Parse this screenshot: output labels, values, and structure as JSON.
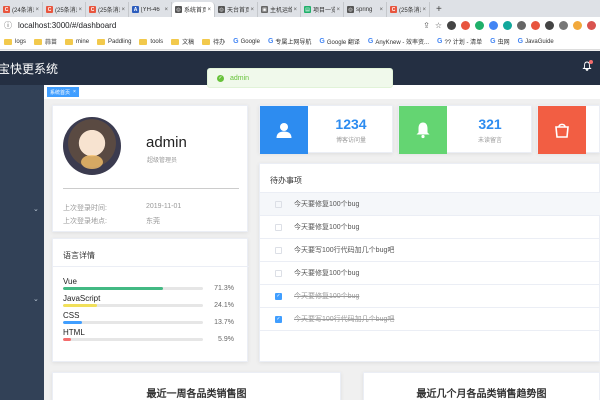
{
  "browser": {
    "tabs": [
      {
        "label": "(24条消息",
        "color": "#e8553e",
        "fav": "C",
        "active": false
      },
      {
        "label": "(25条消息",
        "color": "#e8553e",
        "fav": "C",
        "active": false
      },
      {
        "label": "(25条消息",
        "color": "#e8553e",
        "fav": "C",
        "active": false
      },
      {
        "label": "[YH-46",
        "color": "#2d5dbd",
        "fav": "A",
        "active": false
      },
      {
        "label": "系统首页",
        "color": "#555",
        "fav": "◎",
        "active": true
      },
      {
        "label": "天台首页",
        "color": "#555",
        "fav": "◎",
        "active": false
      },
      {
        "label": "主机运维",
        "color": "#666",
        "fav": "▣",
        "active": false
      },
      {
        "label": "项目一览",
        "color": "#1fb06a",
        "fav": "▤",
        "active": false
      },
      {
        "label": "spring",
        "color": "#555",
        "fav": "◎",
        "active": false
      },
      {
        "label": "(25条消息",
        "color": "#e8553e",
        "fav": "C",
        "active": false
      }
    ],
    "new_tab": "+",
    "url": "localhost:3000/#/dashboard",
    "bookmarks": [
      {
        "label": "logs",
        "type": "folder"
      },
      {
        "label": "蒜苗",
        "type": "folder"
      },
      {
        "label": "mine",
        "type": "folder"
      },
      {
        "label": "Paddling",
        "type": "folder"
      },
      {
        "label": "tools",
        "type": "folder"
      },
      {
        "label": "文稿",
        "type": "folder"
      },
      {
        "label": "待办",
        "type": "folder"
      },
      {
        "label": "Google",
        "type": "g"
      },
      {
        "label": "专属上网导航",
        "type": "g"
      },
      {
        "label": "Google 翻译",
        "type": "g"
      },
      {
        "label": "AnyKnew - 效率资...",
        "type": "g"
      },
      {
        "label": "?? 计划 - 清单",
        "type": "g"
      },
      {
        "label": "虫网",
        "type": "g"
      },
      {
        "label": "JavaGuide",
        "type": "g"
      }
    ]
  },
  "app": {
    "title": "宝快更系统",
    "tag_label": "系统首页",
    "tag_close": "×",
    "toast": "admin"
  },
  "user": {
    "name": "admin",
    "role": "超级管理员",
    "last_login_label": "上次登录时间:",
    "last_login_value": "2019-11-01",
    "last_place_label": "上次登录地点:",
    "last_place_value": "东莞"
  },
  "languages": {
    "title": "语言详情",
    "items": [
      {
        "name": "Vue",
        "pct": "71.3%",
        "value": 71.3,
        "color": "#42b983"
      },
      {
        "name": "JavaScript",
        "pct": "24.1%",
        "value": 24.1,
        "color": "#f1e05a"
      },
      {
        "name": "CSS",
        "pct": "13.7%",
        "value": 13.7,
        "color": "#409eff"
      },
      {
        "name": "HTML",
        "pct": "5.9%",
        "value": 5.9,
        "color": "#f56c6c"
      }
    ]
  },
  "stats": [
    {
      "num": "1234",
      "label": "博客访问量",
      "color": "#2d8cf0",
      "icon": "user-icon"
    },
    {
      "num": "321",
      "label": "未读留言",
      "color": "#64d572",
      "icon": "bell-icon"
    },
    {
      "num": "",
      "label": "",
      "color": "#f25e43",
      "icon": "shopping-bag-icon"
    }
  ],
  "todo": {
    "title": "待办事项",
    "items": [
      {
        "text": "今天要修复100个bug",
        "done": false
      },
      {
        "text": "今天要修复100个bug",
        "done": false
      },
      {
        "text": "今天要写100行代码加几个bug吧",
        "done": false
      },
      {
        "text": "今天要修复100个bug",
        "done": false
      },
      {
        "text": "今天要修复100个bug",
        "done": true
      },
      {
        "text": "今天要写100行代码加几个bug吧",
        "done": true
      }
    ]
  },
  "charts": {
    "left_title": "最近一周各品类销售图",
    "right_title": "最近几个月各品类销售趋势图"
  }
}
